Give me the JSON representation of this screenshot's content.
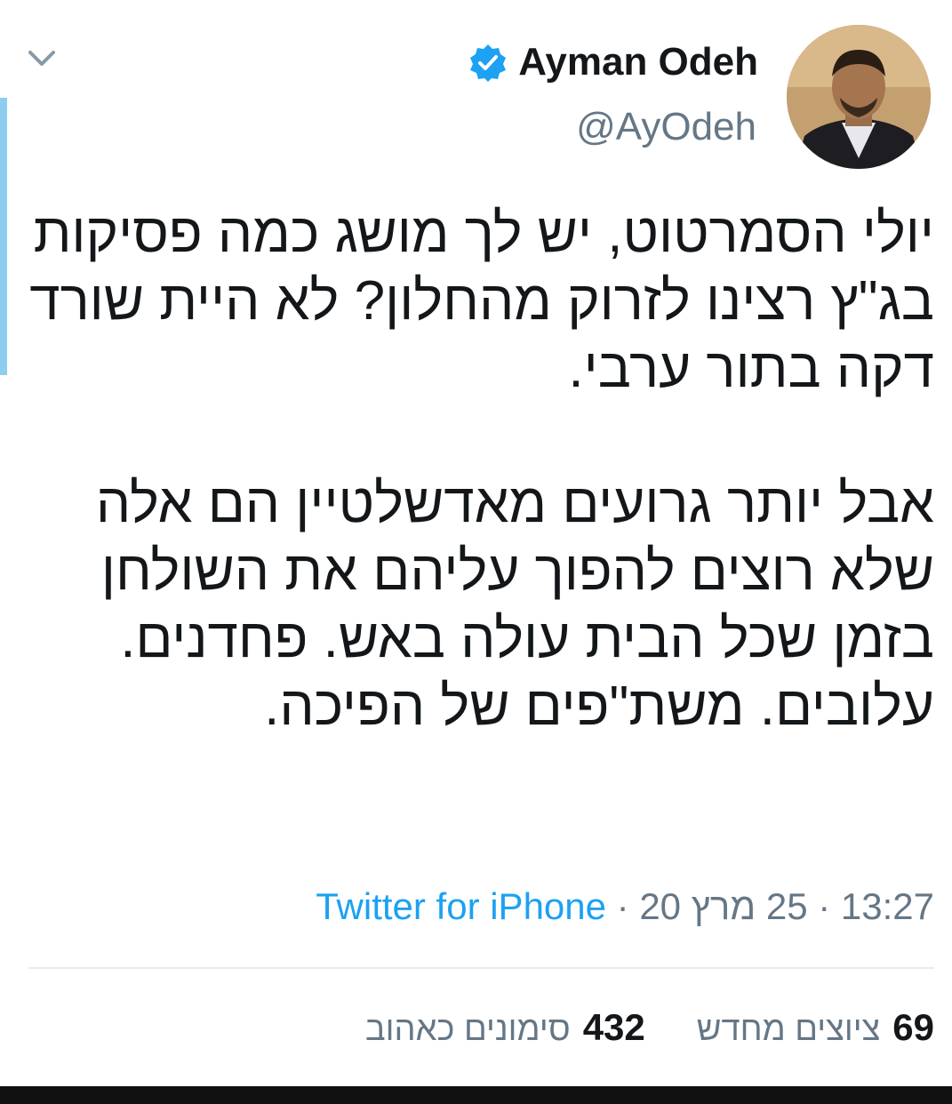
{
  "author": {
    "name": "Ayman Odeh",
    "handle": "@AyOdeh"
  },
  "tweet": {
    "text": "יולי הסמרטוט, יש לך מושג כמה פסיקות בג\"ץ רצינו לזרוק מהחלון? לא היית שורד דקה בתור ערבי.\n\nאבל יותר גרועים מאדשלטיין הם אלה שלא רוצים להפוך עליהם את השולחן בזמן שכל הבית עולה באש. פחדנים. עלובים. משת\"פים של הפיכה."
  },
  "meta": {
    "time": "13:27",
    "sep1": " · ",
    "date": "25 מרץ 20",
    "sep2": " · ",
    "source": "Twitter for iPhone"
  },
  "stats": {
    "retweets_count": "69",
    "retweets_label": "ציוצים מחדש",
    "likes_count": "432",
    "likes_label": "סימונים כאהוב"
  },
  "icons": {
    "verified": "verified-badge-icon",
    "chevron": "chevron-down-icon"
  },
  "colors": {
    "accent": "#1da1f2",
    "secondary_text": "#657786"
  }
}
